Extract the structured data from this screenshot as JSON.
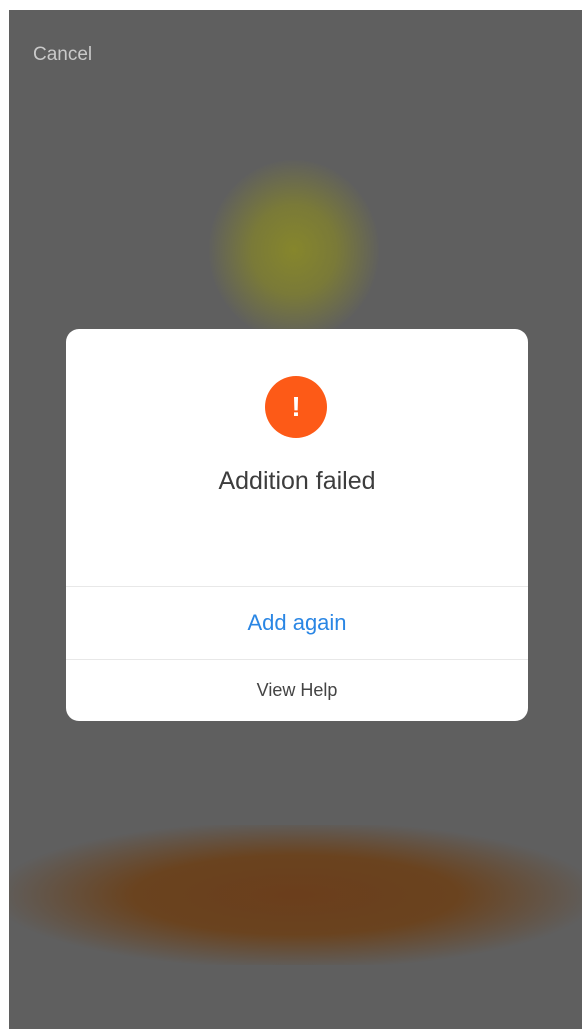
{
  "header": {
    "cancel_label": "Cancel"
  },
  "dialog": {
    "icon": "exclamation-icon",
    "icon_glyph": "!",
    "icon_color": "#fd5a17",
    "title": "Addition failed",
    "primary_action": "Add again",
    "primary_color": "#2a86e4",
    "secondary_action": "View Help"
  }
}
